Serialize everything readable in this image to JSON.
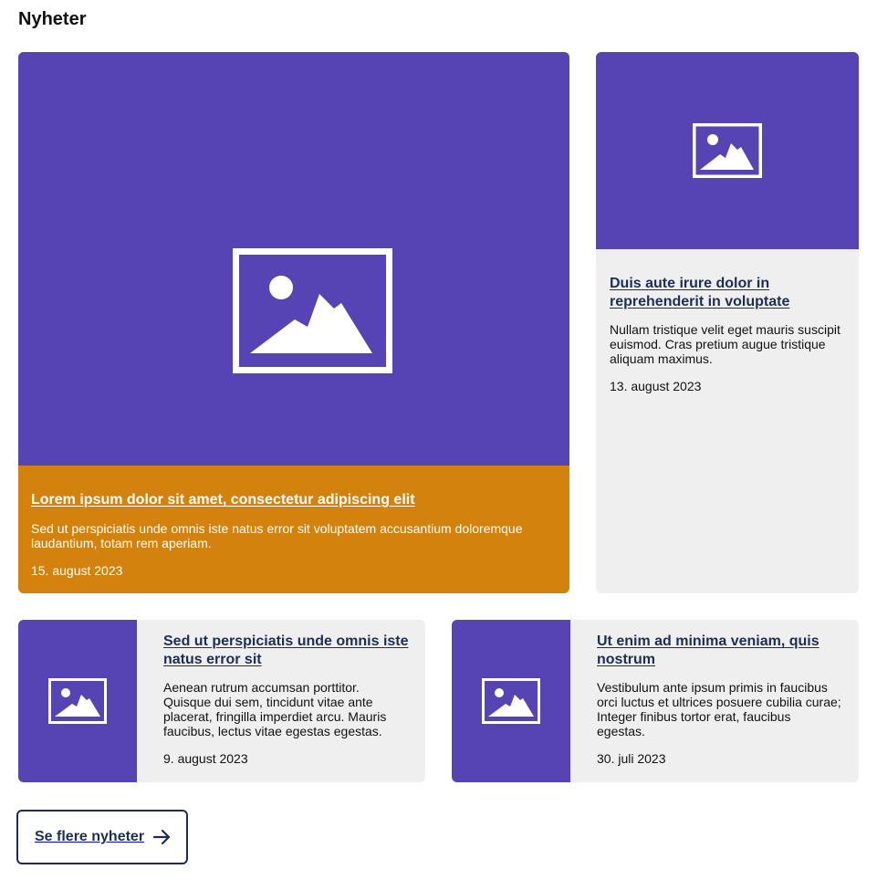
{
  "section": {
    "title": "Nyheter"
  },
  "colors": {
    "image_bg": "#5644B5",
    "featured_bg": "#D4820E",
    "card_bg": "#EFEFEF",
    "link": "#1B2F55"
  },
  "articles": [
    {
      "image_icon": "image-placeholder-icon",
      "title": "Lorem ipsum dolor sit amet, consectetur adipiscing elit",
      "excerpt": "Sed ut perspiciatis unde omnis iste natus error sit voluptatem accusantium doloremque laudantium, totam rem aperiam.",
      "date": "15. august 2023"
    },
    {
      "image_icon": "image-placeholder-icon",
      "title": "Duis aute irure dolor in reprehenderit in voluptate",
      "excerpt": "Nullam tristique velit eget mauris suscipit euismod. Cras pretium augue tristique aliquam maximus.",
      "date": "13. august 2023"
    },
    {
      "image_icon": "image-placeholder-icon",
      "title": "Sed ut perspiciatis unde omnis iste natus error sit",
      "excerpt": "Aenean rutrum accumsan porttitor. Quisque dui sem, tincidunt vitae ante placerat, fringilla imperdiet arcu. Mauris faucibus, lectus vitae egestas egestas.",
      "date": "9. august 2023"
    },
    {
      "image_icon": "image-placeholder-icon",
      "title": "Ut enim ad minima veniam, quis nostrum",
      "excerpt": "Vestibulum ante ipsum primis in faucibus orci luctus et ultrices posuere cubilia curae; Integer finibus tortor erat, faucibus egestas.",
      "date": "30. juli 2023"
    }
  ],
  "more_button": {
    "label": "Se flere nyheter",
    "icon": "arrow-right-icon"
  }
}
